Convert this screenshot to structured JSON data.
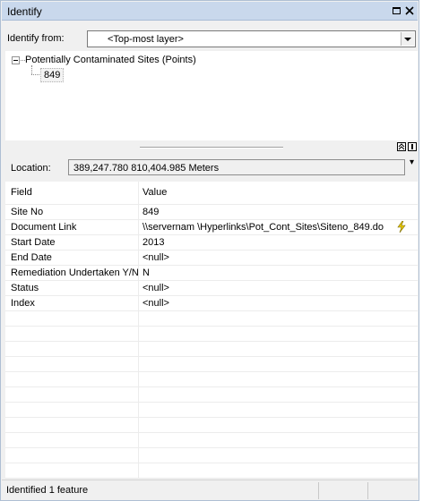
{
  "window": {
    "title": "Identify"
  },
  "identify_from": {
    "label": "Identify from:",
    "selected": "<Top-most layer>"
  },
  "tree": {
    "layer_name": "Potentially Contaminated Sites (Points)",
    "feature_label": "849"
  },
  "location": {
    "label": "Location:",
    "value": "389,247.780  810,404.985 Meters"
  },
  "grid": {
    "headers": {
      "field": "Field",
      "value": "Value"
    },
    "rows": [
      {
        "field": "Site No",
        "value": "849"
      },
      {
        "field": "Document Link",
        "value": "\\\\servernam   \\Hyperlinks\\Pot_Cont_Sites\\Siteno_849.do"
      },
      {
        "field": "Start Date",
        "value": "2013"
      },
      {
        "field": "End Date",
        "value": "<null>"
      },
      {
        "field": "Remediation Undertaken Y/N",
        "value": "N"
      },
      {
        "field": "Status",
        "value": "<null>"
      },
      {
        "field": "Index",
        "value": "<null>"
      }
    ]
  },
  "status": {
    "text": "Identified 1 feature"
  },
  "icons": {
    "restore": "restore-icon",
    "close": "close-icon",
    "dropdown": "chevron-down-icon",
    "hyperlink": "lightning-icon",
    "expand_all": "expand-all-icon",
    "layout": "layout-icon"
  },
  "colors": {
    "titlebar": "#c9d8ec",
    "hyperlink_bolt": "#e8c800"
  }
}
